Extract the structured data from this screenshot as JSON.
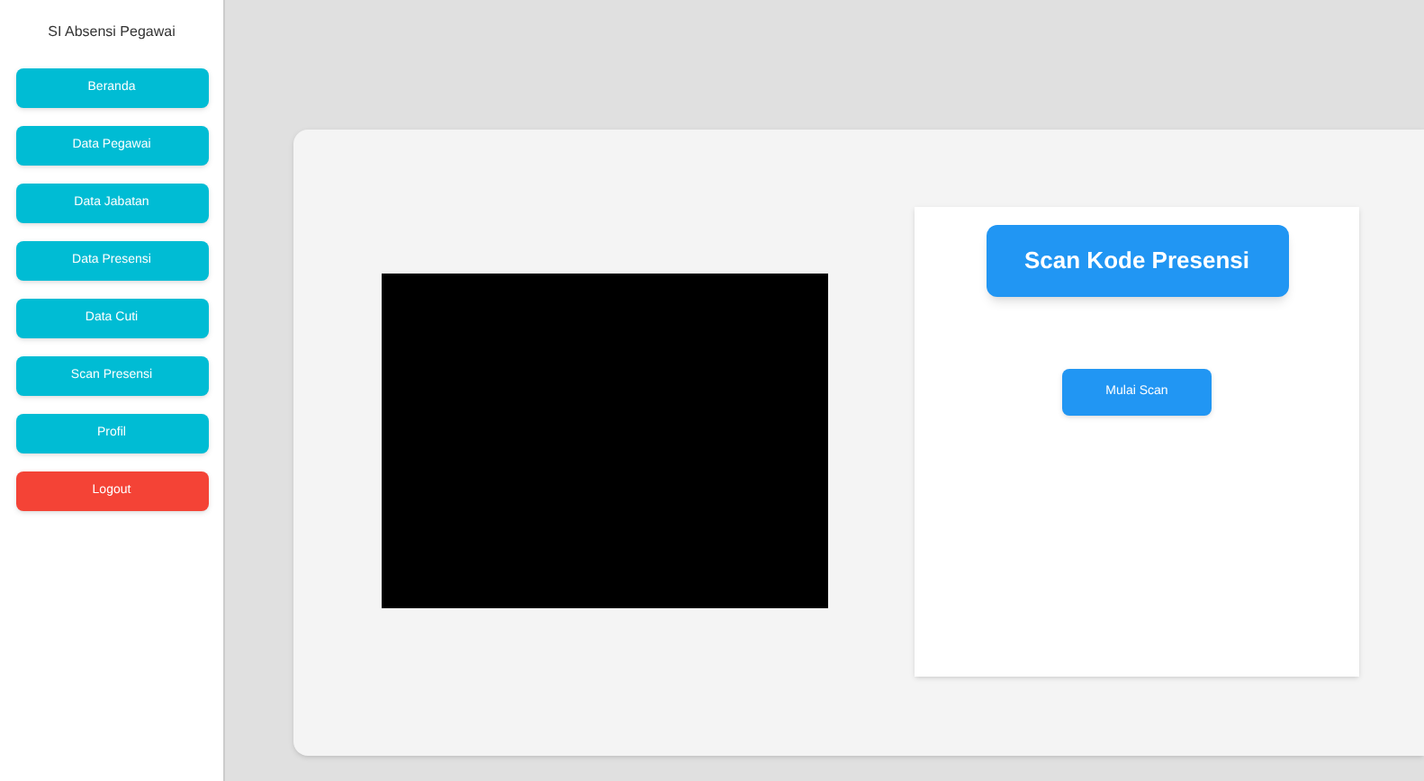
{
  "sidebar": {
    "title": "SI Absensi Pegawai",
    "items": [
      {
        "label": "Beranda",
        "kind": "nav"
      },
      {
        "label": "Data Pegawai",
        "kind": "nav"
      },
      {
        "label": "Data Jabatan",
        "kind": "nav"
      },
      {
        "label": "Data Presensi",
        "kind": "nav"
      },
      {
        "label": "Data Cuti",
        "kind": "nav"
      },
      {
        "label": "Scan Presensi",
        "kind": "nav"
      },
      {
        "label": "Profil",
        "kind": "nav"
      },
      {
        "label": "Logout",
        "kind": "danger"
      }
    ]
  },
  "scanner": {
    "title": "Scan Kode Presensi",
    "button": "Mulai Scan"
  }
}
